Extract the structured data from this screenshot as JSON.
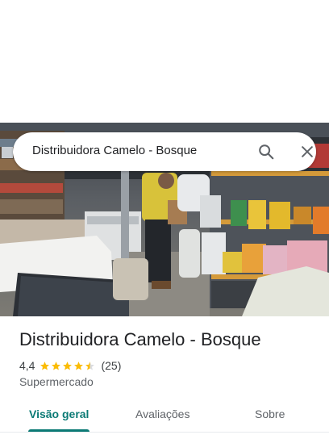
{
  "search": {
    "query": "Distribuidora Camelo - Bosque",
    "search_icon": "search-icon",
    "close_icon": "close-icon"
  },
  "photo": {
    "alt": "store-interior-photo"
  },
  "place": {
    "name": "Distribuidora Camelo - Bosque",
    "rating": "4,4",
    "rating_value": 4.4,
    "review_count": "(25)",
    "category": "Supermercado"
  },
  "tabs": [
    {
      "label": "Visão geral",
      "selected": true
    },
    {
      "label": "Avaliações",
      "selected": false
    },
    {
      "label": "Sobre",
      "selected": false
    }
  ],
  "colors": {
    "accent": "#0b7a75",
    "star": "#fbbc04",
    "star_empty": "#dadce0"
  }
}
